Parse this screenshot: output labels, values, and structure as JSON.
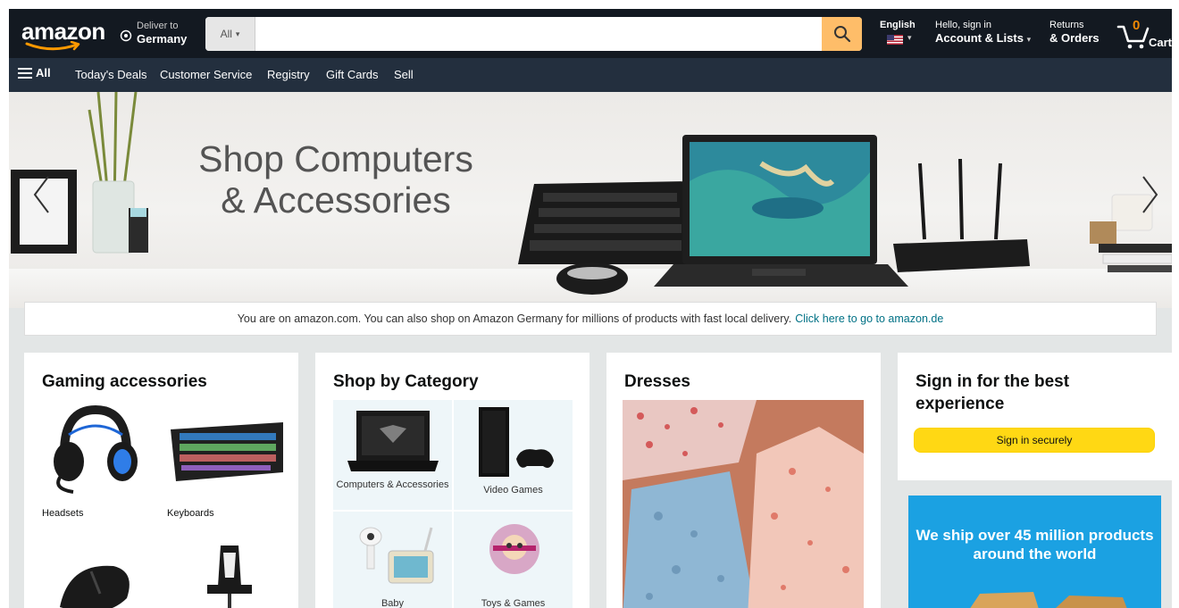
{
  "header": {
    "logo": "amazon",
    "deliver_to_label": "Deliver to",
    "deliver_to_location": "Germany",
    "search_category": "All",
    "search_placeholder": "",
    "language": "English",
    "account_greeting": "Hello, sign in",
    "account_label": "Account & Lists",
    "returns_label": "Returns",
    "orders_label": "& Orders",
    "cart_count": "0",
    "cart_label": "Cart"
  },
  "subnav": {
    "all_label": "All",
    "items": [
      "Today's Deals",
      "Customer Service",
      "Registry",
      "Gift Cards",
      "Sell"
    ]
  },
  "hero": {
    "title_line1": "Shop Computers",
    "title_line2": "& Accessories"
  },
  "info_banner": {
    "text": "You are on amazon.com. You can also shop on Amazon Germany for millions of products with fast local delivery.",
    "link": "Click here to go to amazon.de"
  },
  "cards": {
    "gaming": {
      "title": "Gaming accessories",
      "items": [
        "Headsets",
        "Keyboards"
      ]
    },
    "category": {
      "title": "Shop by Category",
      "items": [
        "Computers & Accessories",
        "Video Games",
        "Baby",
        "Toys & Games"
      ]
    },
    "dresses": {
      "title": "Dresses"
    },
    "signin": {
      "title": "Sign in for the best experience",
      "button": "Sign in securely"
    },
    "shipping": {
      "text": "We ship over 45 million products around the world"
    }
  },
  "colors": {
    "nav_dark": "#131921",
    "nav_sub": "#232f3e",
    "search_button": "#febd69",
    "signin_button": "#ffd814",
    "link": "#007185",
    "ship_banner": "#1ba1e2"
  }
}
